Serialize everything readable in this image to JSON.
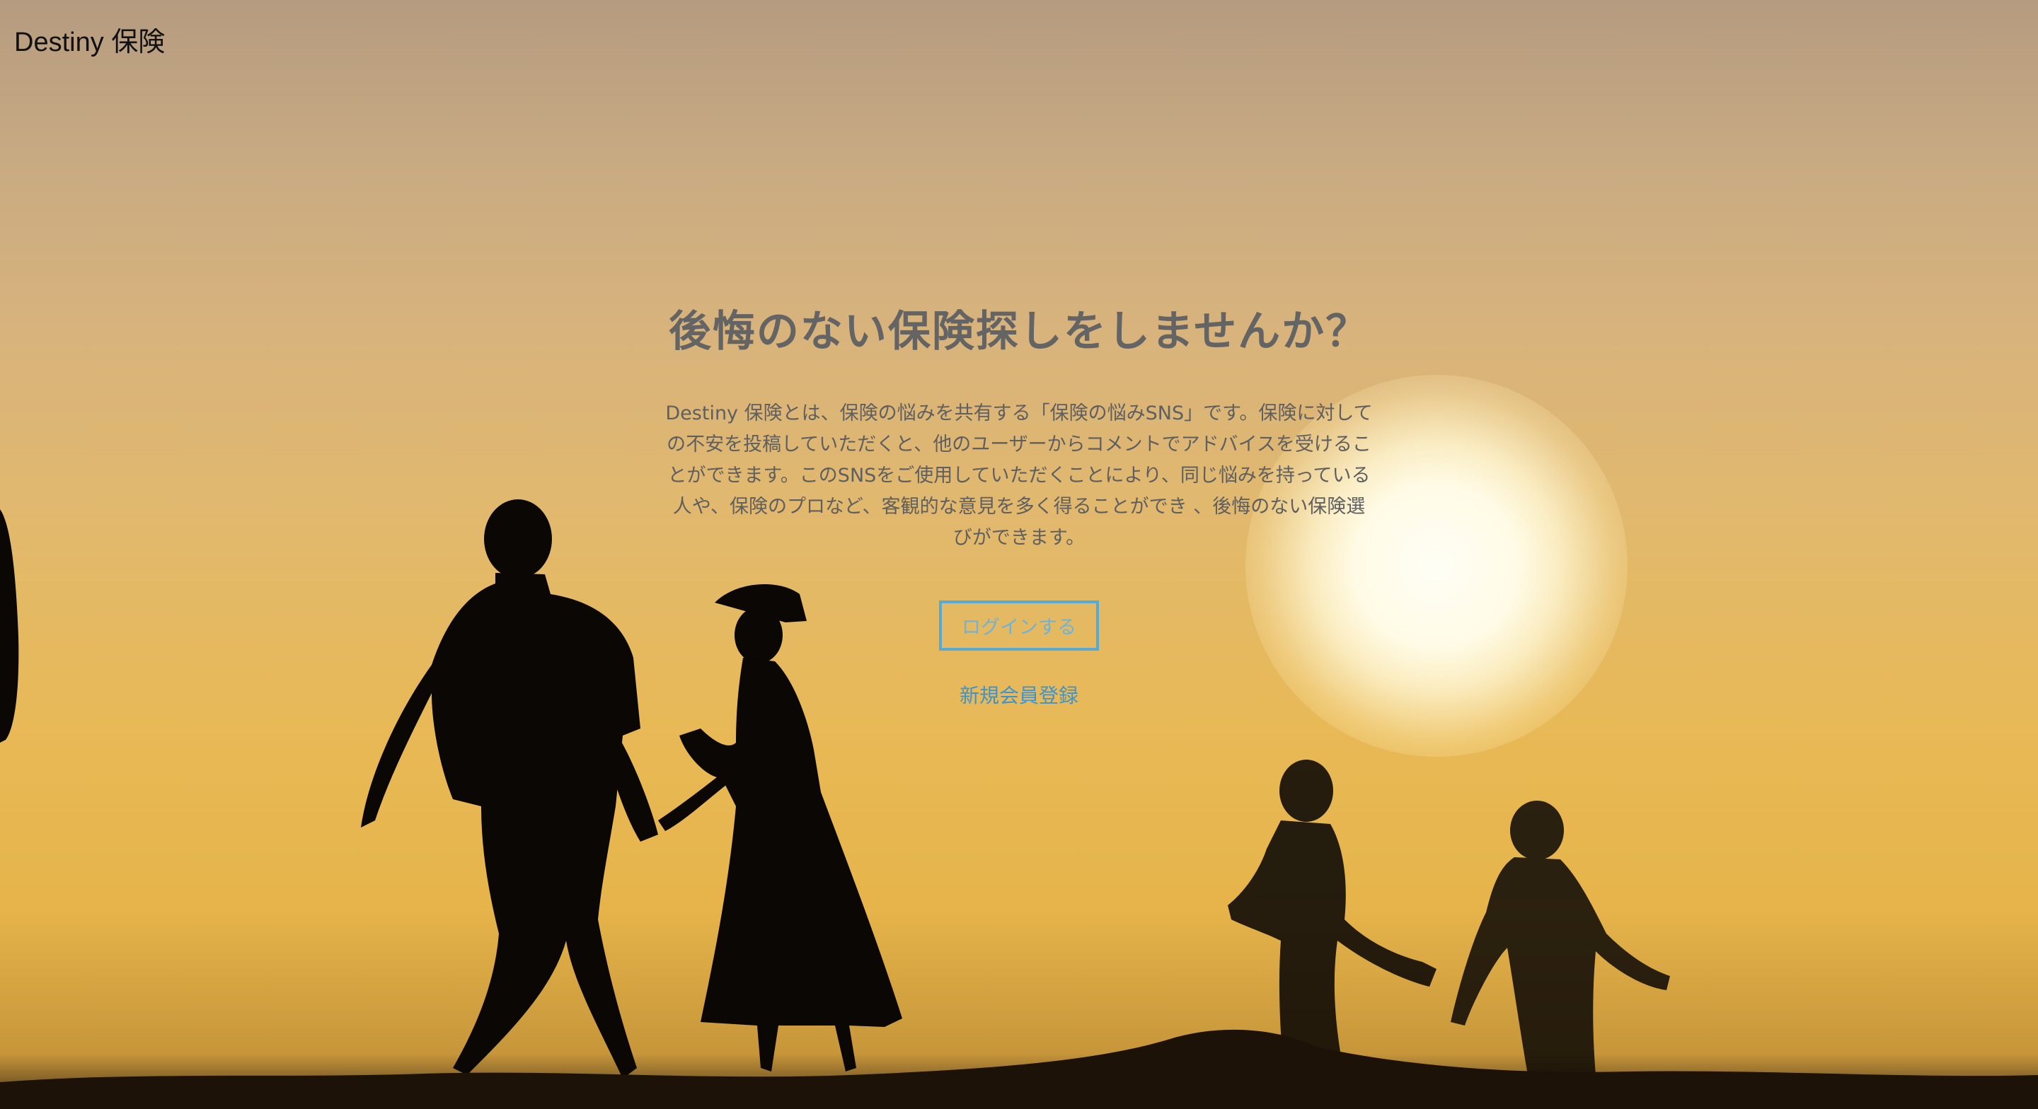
{
  "header": {
    "brand": "Destiny 保険"
  },
  "hero": {
    "headline": "後悔のない保険探しをしませんか？",
    "description": "Destiny 保険とは、保険の悩みを共有する「保険の悩みSNS」です。保険に対しての不安を投稿していただくと、他のユーザーからコメントでアドバイスを受けることができます。このSNSをご使用していただくことにより、同じ悩みを持っている人や、保険のプロなど、客観的な意見を多く得ることができ 、後悔のない保険選びができます。",
    "login_label": "ログインする",
    "signup_label": "新規会員登録"
  },
  "colors": {
    "headline": "#646464",
    "body_text": "#5f5f5f",
    "accent_border": "#55aad8",
    "link": "#3f93cc"
  },
  "background": {
    "scene": "sunset-beach-silhouettes"
  }
}
